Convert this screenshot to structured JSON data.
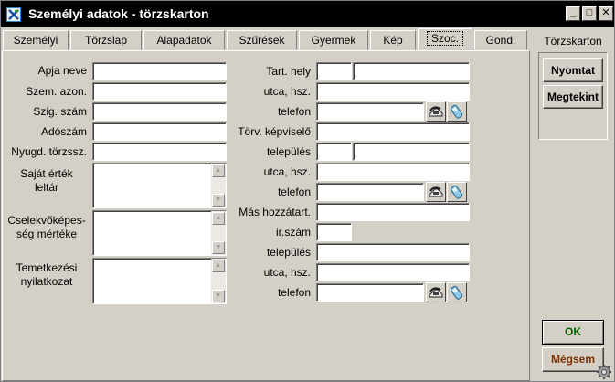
{
  "window": {
    "title": "Személyi adatok - törzskarton",
    "minimize": "_",
    "maximize": "□",
    "close": "✕"
  },
  "tabs": [
    {
      "label": "Személyi"
    },
    {
      "label": "Törzslap"
    },
    {
      "label": "Alapadatok"
    },
    {
      "label": "Szűrések"
    },
    {
      "label": "Gyermek"
    },
    {
      "label": "Kép"
    },
    {
      "label": "Szoc.",
      "active": true
    },
    {
      "label": "Gond."
    }
  ],
  "left": {
    "apja_neve": {
      "label": "Apja neve",
      "value": ""
    },
    "szem_azon": {
      "label": "Szem. azon.",
      "value": ""
    },
    "szig_szam": {
      "label": "Szig. szám",
      "value": ""
    },
    "adoszam": {
      "label": "Adószám",
      "value": ""
    },
    "nyugd": {
      "label": "Nyugd. törzssz.",
      "value": ""
    },
    "sajat_ertek_1": "Saját érték",
    "sajat_ertek_2": "leltár",
    "cselekvo_1": "Cselekvőképes-",
    "cselekvo_2": "ség mértéke",
    "temetkezesi_1": "Temetkezési",
    "temetkezesi_2": "nyilatkozat"
  },
  "right": {
    "tart_hely": "Tart. hely",
    "utca_hsz_1": "utca, hsz.",
    "telefon_1": "telefon",
    "torv_kepviselo": "Törv. képviselő",
    "telepules_1": "település",
    "utca_hsz_2": "utca, hsz.",
    "telefon_2": "telefon",
    "mas_hozzatart": "Más hozzátart.",
    "ir_szam": "ir.szám",
    "telepules_2": "település",
    "utca_hsz_3": "utca, hsz.",
    "telefon_3": "telefon"
  },
  "side": {
    "title": "Törzskarton",
    "print_label": "Nyomtat",
    "view_label": "Megtekint",
    "ok_label": "OK",
    "cancel_label": "Mégsem"
  },
  "icons": {
    "app": "app-x-icon",
    "phone": "phone-icon",
    "mobile": "mobile-phone-icon",
    "settings": "gear-icon"
  },
  "colors": {
    "titlebar": "#000000",
    "ok_text": "#006400",
    "cancel_text": "#7a3000",
    "window_bg": "#d4d0c8"
  }
}
